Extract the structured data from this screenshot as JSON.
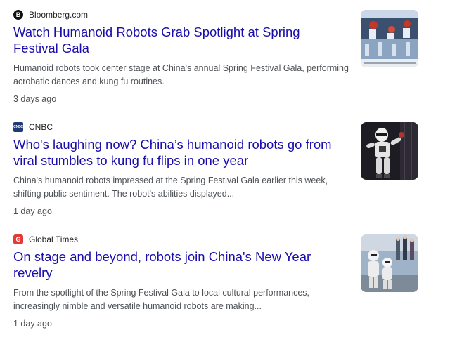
{
  "results": [
    {
      "source": "Bloomberg.com",
      "source_icon": "bloomberg-logo-icon",
      "headline": "Watch Humanoid Robots Grab Spotlight at Spring Festival Gala",
      "snippet": "Humanoid robots took center stage at China's annual Spring Festival Gala, performing acrobatic dances and kung fu routines.",
      "time": "3 days ago",
      "thumbnail": "robots-on-stage-thumbnail"
    },
    {
      "source": "CNBC",
      "source_icon": "cnbc-logo-icon",
      "headline": "Who's laughing now? China’s humanoid robots go from viral stumbles to kung fu flips in one year",
      "snippet": "China's humanoid robots impressed at the Spring Festival Gala earlier this week, shifting public sentiment. The robot's abilities displayed...",
      "time": "1 day ago",
      "thumbnail": "white-humanoid-robot-thumbnail"
    },
    {
      "source": "Global Times",
      "source_icon": "global-times-logo-icon",
      "headline": "On stage and beyond, robots join China's New Year revelry",
      "snippet": "From the spotlight of the Spring Festival Gala to local cultural performances, increasingly nimble and versatile humanoid robots are making...",
      "time": "1 day ago",
      "thumbnail": "robots-and-crowd-thumbnail"
    }
  ],
  "colors": {
    "headline": "#1a0dab",
    "snippet": "#4d5156",
    "source": "#202124"
  }
}
